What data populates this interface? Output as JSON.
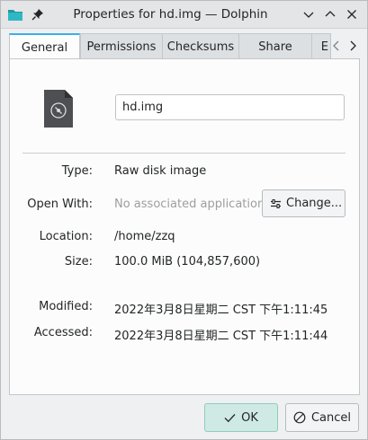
{
  "window": {
    "title": "Properties for hd.img — Dolphin"
  },
  "tabs": [
    {
      "label": "General",
      "active": true
    },
    {
      "label": "Permissions",
      "active": false
    },
    {
      "label": "Checksums",
      "active": false
    },
    {
      "label": "Share",
      "active": false
    },
    {
      "label": "E",
      "active": false
    }
  ],
  "general": {
    "file_name": "hd.img",
    "type": {
      "label": "Type:",
      "value": "Raw disk image"
    },
    "open_with": {
      "label": "Open With:",
      "value": "No associated application",
      "button": "Change..."
    },
    "location": {
      "label": "Location:",
      "value": "/home/zzq"
    },
    "size": {
      "label": "Size:",
      "value": "100.0 MiB (104,857,600)"
    },
    "modified": {
      "label": "Modified:",
      "value": "2022年3月8日星期二 CST 下午1:11:45"
    },
    "accessed": {
      "label": "Accessed:",
      "value": "2022年3月8日星期二 CST 下午1:11:44"
    }
  },
  "buttons": {
    "ok": "OK",
    "cancel": "Cancel"
  },
  "icons": {
    "app": "folder-icon",
    "pin": "pin-icon",
    "file": "disk-image-file-icon"
  },
  "colors": {
    "accent": "#3daee9",
    "ok_bg": "#cfe9e4",
    "folder": "#1d99a3"
  }
}
